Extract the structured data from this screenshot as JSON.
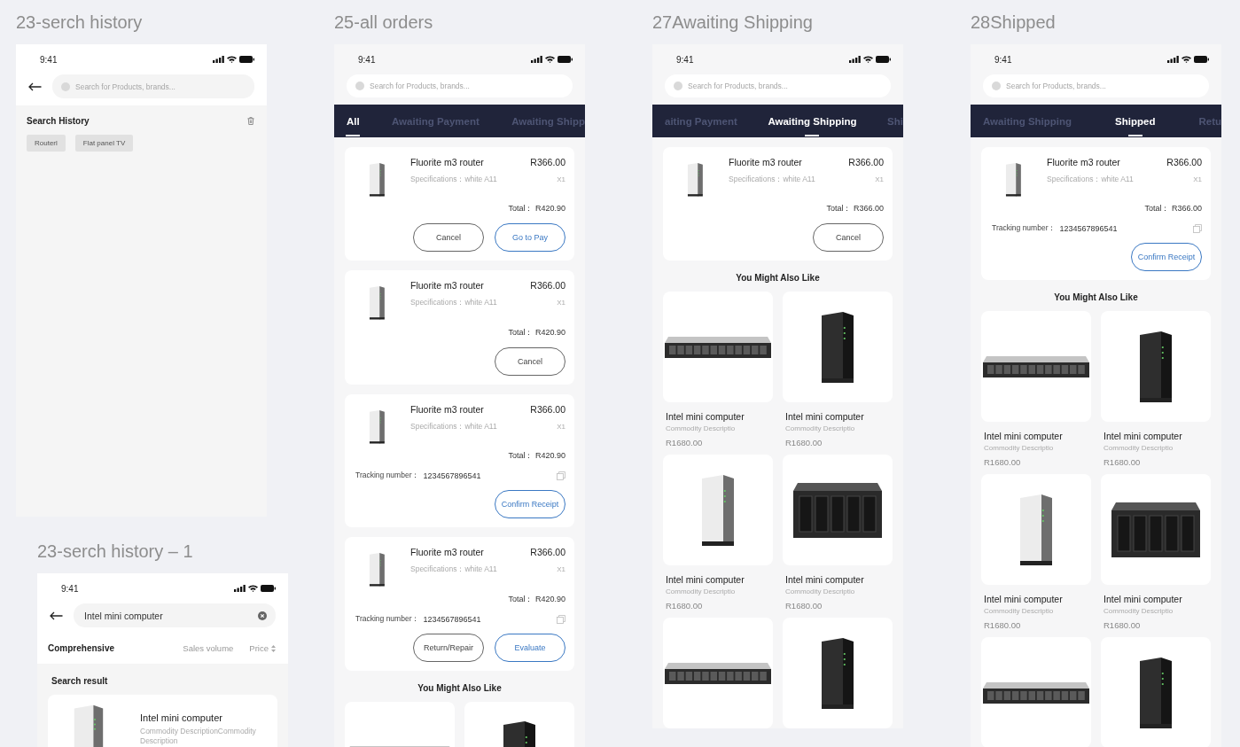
{
  "columns": [
    [
      {
        "title": "23-serch history",
        "kind": "history",
        "time": "9:41",
        "search": {
          "placeholder": "Search for Products, brands..."
        },
        "history": {
          "heading": "Search History",
          "tags": [
            "Routerl",
            "Flat panel TV"
          ]
        }
      },
      {
        "title": "23-serch history – 1",
        "kind": "results",
        "time": "9:41",
        "search": {
          "value": "Intel mini computer"
        },
        "sort": [
          {
            "label": "Comprehensive",
            "selected": true,
            "sortable": false
          },
          {
            "label": "Sales volume",
            "selected": false,
            "sortable": false
          },
          {
            "label": "Price",
            "selected": false,
            "sortable": true
          }
        ],
        "section": "Search result",
        "results": [
          {
            "name": "Intel mini computer",
            "description": "Commodity DescriptionCommodity Description",
            "kind": "tower-white"
          }
        ]
      }
    ],
    [
      {
        "title": "25-all orders",
        "kind": "orders",
        "time": "9:41",
        "search": {
          "placeholder": "Search for Products, brands..."
        },
        "tabs": [
          {
            "label": "All",
            "selected": true
          },
          {
            "label": "Awaiting Payment",
            "selected": false
          },
          {
            "label": "Awaiting Shipp",
            "selected": false
          }
        ],
        "orders": [
          {
            "name": "Fluorite m3 router",
            "price": "R366.00",
            "spec": "Specifications：white A11",
            "qty": "X1",
            "total": "Total： R420.90",
            "actions": [
              {
                "label": "Cancel",
                "primary": false
              },
              {
                "label": "Go to Pay",
                "primary": true
              }
            ]
          },
          {
            "name": "Fluorite m3 router",
            "price": "R366.00",
            "spec": "Specifications：white A11",
            "qty": "X1",
            "total": "Total： R420.90",
            "actions": [
              {
                "label": "Cancel",
                "primary": false
              }
            ]
          },
          {
            "name": "Fluorite m3 router",
            "price": "R366.00",
            "spec": "Specifications：white A11",
            "qty": "X1",
            "total": "Total： R420.90",
            "tracking_label": "Tracking number：",
            "tracking_number": "1234567896541",
            "actions": [
              {
                "label": "Confirm Receipt",
                "primary": true
              }
            ]
          },
          {
            "name": "Fluorite m3 router",
            "price": "R366.00",
            "spec": "Specifications：white A11",
            "qty": "X1",
            "total": "Total： R420.90",
            "tracking_label": "Tracking number：",
            "tracking_number": "1234567896541",
            "actions": [
              {
                "label": "Return/Repair",
                "primary": false
              },
              {
                "label": "Evaluate",
                "primary": true
              }
            ]
          }
        ],
        "recommend": {
          "heading": "You Might Also Like",
          "products": [
            {
              "kind": "rack"
            },
            {
              "kind": "tower-black"
            }
          ]
        }
      }
    ],
    [
      {
        "title": "27Awaiting Shipping",
        "kind": "orders",
        "time": "9:41",
        "search": {
          "placeholder": "Search for Products, brands..."
        },
        "tabs": [
          {
            "label": "aiting Payment",
            "selected": false
          },
          {
            "label": "Awaiting Shipping",
            "selected": true
          },
          {
            "label": "Shi",
            "selected": false
          }
        ],
        "orders": [
          {
            "name": "Fluorite m3 router",
            "price": "R366.00",
            "spec": "Specifications：white A11",
            "qty": "X1",
            "total": "Total： R366.00",
            "actions": [
              {
                "label": "Cancel",
                "primary": false
              }
            ]
          }
        ],
        "recommend": {
          "heading": "You Might Also Like",
          "products": [
            {
              "kind": "rack",
              "name": "Intel mini computer",
              "description": "Commodity Descriptio",
              "price": "R1680.00"
            },
            {
              "kind": "tower-black",
              "name": "Intel mini computer",
              "description": "Commodity Descriptio",
              "price": "R1680.00"
            },
            {
              "kind": "tower-white",
              "name": "Intel mini computer",
              "description": "Commodity Descriptio",
              "price": "R1680.00"
            },
            {
              "kind": "nas-5bay",
              "name": "Intel mini computer",
              "description": "Commodity Descriptio",
              "price": "R1680.00"
            },
            {
              "kind": "rack"
            },
            {
              "kind": "tower-black"
            }
          ]
        }
      }
    ],
    [
      {
        "title": "28Shipped",
        "kind": "orders",
        "time": "9:41",
        "search": {
          "placeholder": "Search for Products, brands..."
        },
        "tabs": [
          {
            "label": "Awaiting Shipping",
            "selected": false
          },
          {
            "label": "Shipped",
            "selected": true
          },
          {
            "label": "Retu",
            "selected": false
          }
        ],
        "orders": [
          {
            "name": "Fluorite m3 router",
            "price": "R366.00",
            "spec": "Specifications：white A11",
            "qty": "X1",
            "total": "Total： R366.00",
            "tracking_label": "Tracking number：",
            "tracking_number": "1234567896541",
            "actions": [
              {
                "label": "Confirm Receipt",
                "primary": true
              }
            ]
          }
        ],
        "recommend": {
          "heading": "You Might Also Like",
          "products": [
            {
              "kind": "rack",
              "name": "Intel mini computer",
              "description": "Commodity Descriptio",
              "price": "R1680.00"
            },
            {
              "kind": "tower-black",
              "name": "Intel mini computer",
              "description": "Commodity Descriptio",
              "price": "R1680.00"
            },
            {
              "kind": "tower-white",
              "name": "Intel mini computer",
              "description": "Commodity Descriptio",
              "price": "R1680.00"
            },
            {
              "kind": "nas-5bay",
              "name": "Intel mini computer",
              "description": "Commodity Descriptio",
              "price": "R1680.00"
            },
            {
              "kind": "rack"
            },
            {
              "kind": "tower-black"
            }
          ]
        }
      }
    ]
  ]
}
